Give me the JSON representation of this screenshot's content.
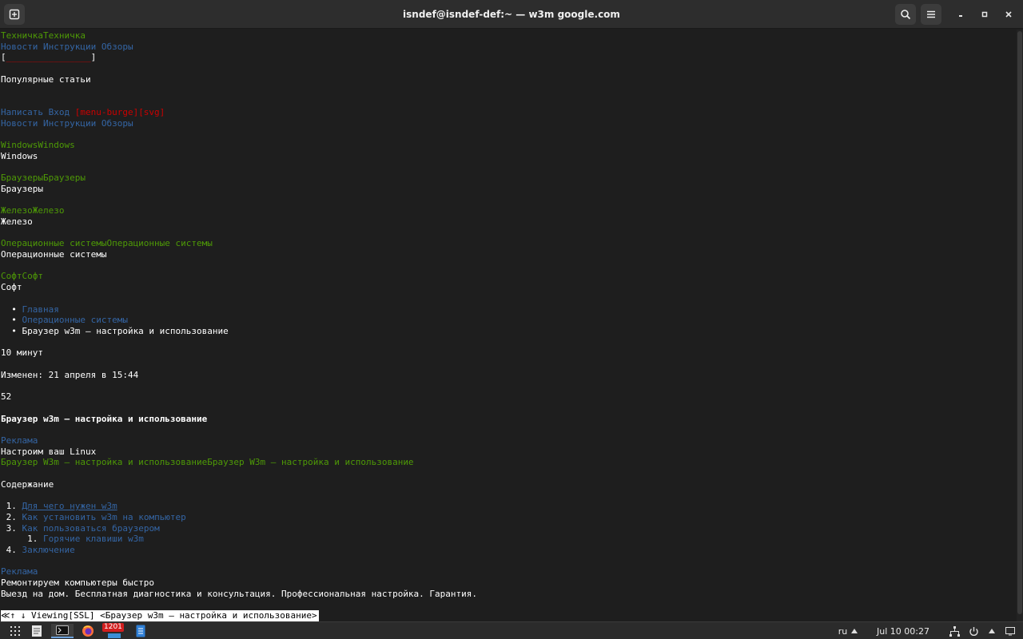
{
  "window": {
    "title": "isndef@isndef-def:~ — w3m google.com"
  },
  "terminal": {
    "lines": [
      {
        "row": 0,
        "segments": [
          {
            "text": "ТехничкаТехничка",
            "style": "green"
          }
        ]
      },
      {
        "row": 1,
        "segments": [
          {
            "text": "Новости Инструкции Обзоры",
            "style": "blue"
          }
        ]
      },
      {
        "row": 2,
        "segments": [
          {
            "text": "[",
            "style": "plain"
          },
          {
            "text": "________________",
            "style": "red"
          },
          {
            "text": "]",
            "style": "plain"
          }
        ]
      },
      {
        "row": 4,
        "segments": [
          {
            "text": "Популярные статьи",
            "style": "plain"
          }
        ]
      },
      {
        "row": 7,
        "segments": [
          {
            "text": "Написать Вход ",
            "style": "blue"
          },
          {
            "text": "[menu-burge][svg]",
            "style": "red"
          }
        ]
      },
      {
        "row": 8,
        "segments": [
          {
            "text": "Новости Инструкции Обзоры",
            "style": "blue"
          }
        ]
      },
      {
        "row": 10,
        "segments": [
          {
            "text": "WindowsWindows",
            "style": "green"
          }
        ]
      },
      {
        "row": 11,
        "segments": [
          {
            "text": "Windows",
            "style": "plain"
          }
        ]
      },
      {
        "row": 13,
        "segments": [
          {
            "text": "БраузерыБраузеры",
            "style": "green"
          }
        ]
      },
      {
        "row": 14,
        "segments": [
          {
            "text": "Браузеры",
            "style": "plain"
          }
        ]
      },
      {
        "row": 16,
        "segments": [
          {
            "text": "ЖелезоЖелезо",
            "style": "green"
          }
        ]
      },
      {
        "row": 17,
        "segments": [
          {
            "text": "Железо",
            "style": "plain"
          }
        ]
      },
      {
        "row": 19,
        "segments": [
          {
            "text": "Операционные системыОперационные системы",
            "style": "green"
          }
        ]
      },
      {
        "row": 20,
        "segments": [
          {
            "text": "Операционные системы",
            "style": "plain"
          }
        ]
      },
      {
        "row": 22,
        "segments": [
          {
            "text": "СофтСофт",
            "style": "green"
          }
        ]
      },
      {
        "row": 23,
        "segments": [
          {
            "text": "Софт",
            "style": "plain"
          }
        ]
      },
      {
        "row": 25,
        "segments": [
          {
            "text": "  • ",
            "style": "plain"
          },
          {
            "text": "Главная",
            "style": "blue"
          }
        ]
      },
      {
        "row": 26,
        "segments": [
          {
            "text": "  • ",
            "style": "plain"
          },
          {
            "text": "Операционные системы",
            "style": "blue"
          }
        ]
      },
      {
        "row": 27,
        "segments": [
          {
            "text": "  • Браузер w3m – настройка и использование",
            "style": "plain"
          }
        ]
      },
      {
        "row": 29,
        "segments": [
          {
            "text": "10 минут",
            "style": "plain"
          }
        ]
      },
      {
        "row": 31,
        "segments": [
          {
            "text": "Изменен: 21 апреля в 15:44",
            "style": "plain"
          }
        ]
      },
      {
        "row": 33,
        "segments": [
          {
            "text": "52",
            "style": "plain"
          }
        ]
      },
      {
        "row": 35,
        "segments": [
          {
            "text": "Браузер w3m – настройка и использование",
            "style": "bold"
          }
        ]
      },
      {
        "row": 37,
        "segments": [
          {
            "text": "Реклама",
            "style": "blue"
          }
        ]
      },
      {
        "row": 38,
        "segments": [
          {
            "text": "Настроим ваш Linux",
            "style": "plain"
          }
        ]
      },
      {
        "row": 39,
        "segments": [
          {
            "text": "Браузер W3m – настройка и использованиеБраузер W3m – настройка и использование",
            "style": "green"
          }
        ]
      },
      {
        "row": 41,
        "segments": [
          {
            "text": "Содержание",
            "style": "plain"
          }
        ]
      },
      {
        "row": 43,
        "segments": [
          {
            "text": " 1. ",
            "style": "plain"
          },
          {
            "text": "Для чего нужен w3m",
            "style": "blue-ul"
          }
        ]
      },
      {
        "row": 44,
        "segments": [
          {
            "text": " 2. ",
            "style": "plain"
          },
          {
            "text": "Как установить w3m на компьютер",
            "style": "blue"
          }
        ]
      },
      {
        "row": 45,
        "segments": [
          {
            "text": " 3. ",
            "style": "plain"
          },
          {
            "text": "Как пользоваться браузером",
            "style": "blue"
          }
        ]
      },
      {
        "row": 46,
        "segments": [
          {
            "text": "     1. ",
            "style": "plain"
          },
          {
            "text": "Горячие клавиши w3m",
            "style": "blue"
          }
        ]
      },
      {
        "row": 47,
        "segments": [
          {
            "text": " 4. ",
            "style": "plain"
          },
          {
            "text": "Заключение",
            "style": "blue"
          }
        ]
      },
      {
        "row": 49,
        "segments": [
          {
            "text": "Реклама",
            "style": "blue"
          }
        ]
      },
      {
        "row": 50,
        "segments": [
          {
            "text": "Ремонтируем компьютеры быстро",
            "style": "plain"
          }
        ]
      },
      {
        "row": 51,
        "segments": [
          {
            "text": "Выезд на дом. Бесплатная диагностика и консультация. Профессиональная настройка. Гарантия.",
            "style": "plain"
          }
        ]
      }
    ],
    "status_line": "≪↑ ↓ Viewing[SSL] <Браузер w3m – настройка и использование>"
  },
  "taskbar": {
    "badge_count": "1201",
    "keyboard_layout": "ru",
    "datetime": "Jul 10  00:27"
  }
}
